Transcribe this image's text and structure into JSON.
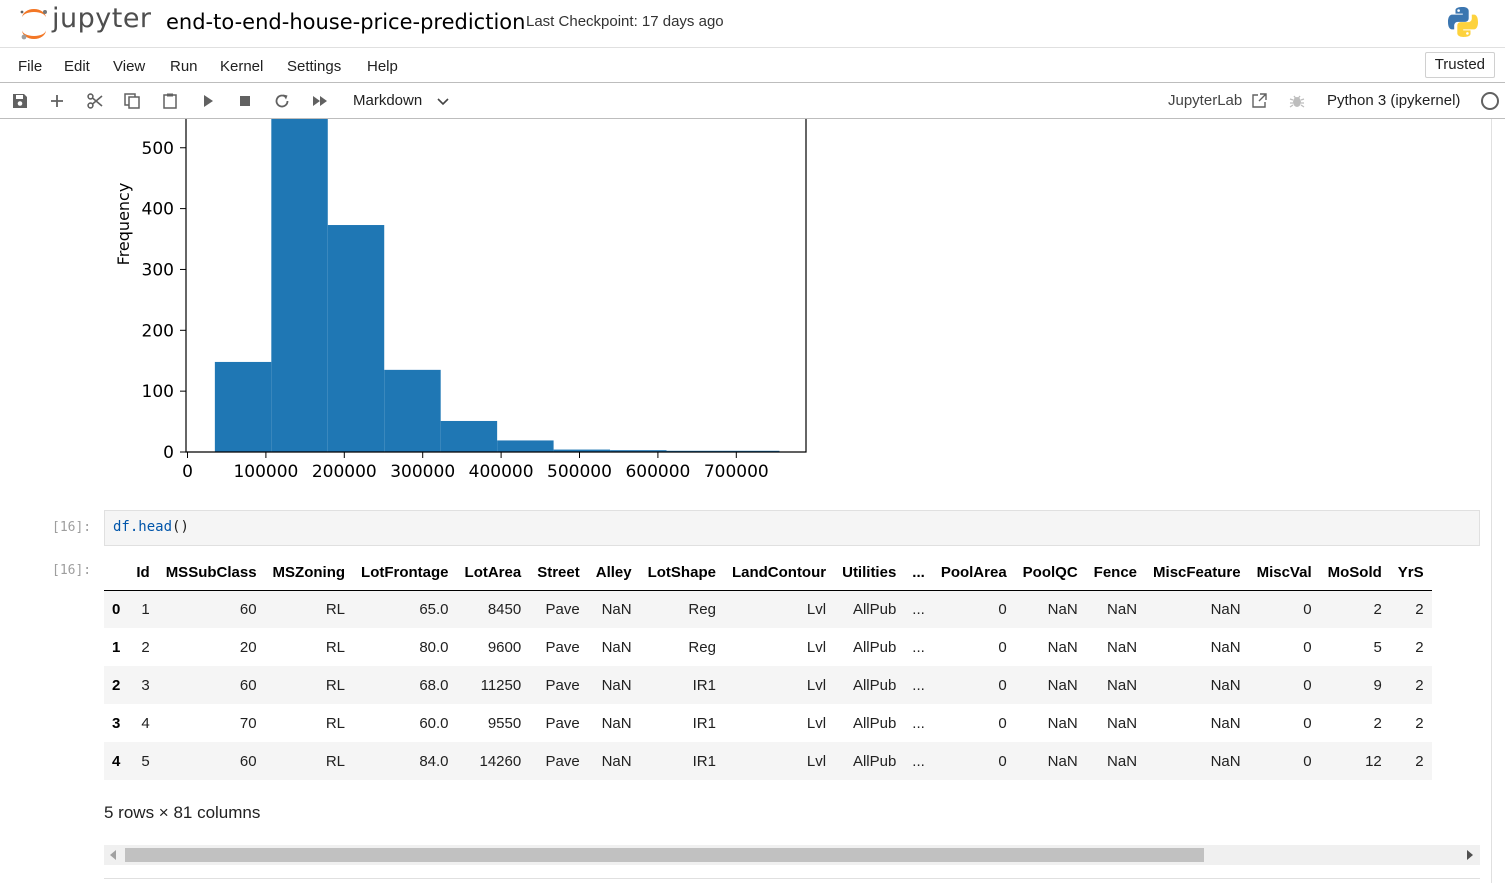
{
  "header": {
    "logo_text": "jupyter",
    "notebook_title": "end-to-end-house-price-prediction",
    "checkpoint": "Last Checkpoint: 17 days ago"
  },
  "menu": {
    "items": [
      "File",
      "Edit",
      "View",
      "Run",
      "Kernel",
      "Settings",
      "Help"
    ],
    "trusted": "Trusted"
  },
  "toolbar": {
    "icons": [
      "save-icon",
      "add-icon",
      "cut-icon",
      "copy-icon",
      "paste-icon",
      "run-icon",
      "stop-icon",
      "restart-icon",
      "fast-forward-icon"
    ],
    "cell_type": "Markdown",
    "jupyterlab_link": "JupyterLab",
    "kernel_name": "Python 3 (ipykernel)"
  },
  "chart_data": {
    "type": "bar",
    "ylabel": "Frequency",
    "xlabel": "",
    "bins": [
      34900,
      106910,
      178920,
      250930,
      322940,
      394950,
      466960,
      538970,
      610980,
      682990,
      755000
    ],
    "values": [
      148,
      723,
      373,
      135,
      51,
      19,
      4,
      3,
      2,
      2
    ],
    "yticks": [
      0,
      100,
      200,
      300,
      400,
      500
    ],
    "xticks": [
      0,
      100000,
      200000,
      300000,
      400000,
      500000,
      600000,
      700000
    ],
    "ylim": [
      0,
      500
    ],
    "color": "#1f77b4"
  },
  "cell": {
    "in_prompt": "[16]:",
    "out_prompt": "[16]:",
    "code_fn": "df.head",
    "code_rest": "()"
  },
  "dataframe": {
    "columns": [
      "",
      "Id",
      "MSSubClass",
      "MSZoning",
      "LotFrontage",
      "LotArea",
      "Street",
      "Alley",
      "LotShape",
      "LandContour",
      "Utilities",
      "...",
      "PoolArea",
      "PoolQC",
      "Fence",
      "MiscFeature",
      "MiscVal",
      "MoSold",
      "YrS"
    ],
    "rows": [
      [
        "0",
        "1",
        "60",
        "RL",
        "65.0",
        "8450",
        "Pave",
        "NaN",
        "Reg",
        "Lvl",
        "AllPub",
        "...",
        "0",
        "NaN",
        "NaN",
        "NaN",
        "0",
        "2",
        "2"
      ],
      [
        "1",
        "2",
        "20",
        "RL",
        "80.0",
        "9600",
        "Pave",
        "NaN",
        "Reg",
        "Lvl",
        "AllPub",
        "...",
        "0",
        "NaN",
        "NaN",
        "NaN",
        "0",
        "5",
        "2"
      ],
      [
        "2",
        "3",
        "60",
        "RL",
        "68.0",
        "11250",
        "Pave",
        "NaN",
        "IR1",
        "Lvl",
        "AllPub",
        "...",
        "0",
        "NaN",
        "NaN",
        "NaN",
        "0",
        "9",
        "2"
      ],
      [
        "3",
        "4",
        "70",
        "RL",
        "60.0",
        "9550",
        "Pave",
        "NaN",
        "IR1",
        "Lvl",
        "AllPub",
        "...",
        "0",
        "NaN",
        "NaN",
        "NaN",
        "0",
        "2",
        "2"
      ],
      [
        "4",
        "5",
        "60",
        "RL",
        "84.0",
        "14260",
        "Pave",
        "NaN",
        "IR1",
        "Lvl",
        "AllPub",
        "...",
        "0",
        "NaN",
        "NaN",
        "NaN",
        "0",
        "12",
        "2"
      ]
    ],
    "shape_text": "5 rows × 81 columns"
  }
}
